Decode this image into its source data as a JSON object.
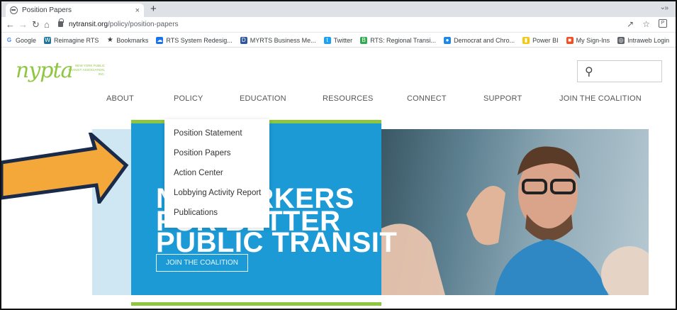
{
  "browser": {
    "tab_title": "Position Papers",
    "tab_close": "×",
    "new_tab": "+",
    "url_domain": "nytransit.org",
    "url_path": "/policy/position-papers"
  },
  "bookmarks": [
    {
      "label": "Google",
      "icon": "google-icon",
      "color": "#4285f4"
    },
    {
      "label": "Reimagine RTS",
      "icon": "wordpress-icon",
      "color": "#21759b"
    },
    {
      "label": "Bookmarks",
      "icon": "star-icon",
      "color": "#3c4043"
    },
    {
      "label": "RTS System Redesig...",
      "icon": "cloud-icon",
      "color": "#1a73e8"
    },
    {
      "label": "MYRTS Business Me...",
      "icon": "app-icon",
      "color": "#2b579a"
    },
    {
      "label": "Twitter",
      "icon": "twitter-icon",
      "color": "#1da1f2"
    },
    {
      "label": "RTS: Regional Transi...",
      "icon": "bus-icon",
      "color": "#34a853"
    },
    {
      "label": "Democrat and Chro...",
      "icon": "news-icon",
      "color": "#1e88e5"
    },
    {
      "label": "Power BI",
      "icon": "powerbi-icon",
      "color": "#f2c811"
    },
    {
      "label": "My Sign-Ins",
      "icon": "microsoft-icon",
      "color": "#f25022"
    },
    {
      "label": "Intraweb Login",
      "icon": "globe-icon",
      "color": "#5f6368"
    }
  ],
  "site": {
    "logo": "nypta",
    "logo_sub": "NEW YORK PUBLIC TRANSIT ASSOCIATION, INC.",
    "nav": [
      "ABOUT",
      "POLICY",
      "EDUCATION",
      "RESOURCES",
      "CONNECT",
      "SUPPORT",
      "JOIN THE COALITION"
    ],
    "dropdown": [
      "Position Statement",
      "Position Papers",
      "Action Center",
      "Lobbying Activity Report",
      "Publications"
    ],
    "hero_lines": [
      "NY WORKERS",
      "FOR BETTER",
      "PUBLIC TRANSIT"
    ],
    "hero_cta": "JOIN THE COALITION"
  },
  "colors": {
    "brand_green": "#8dc63f",
    "hero_blue": "#1b9ad6",
    "arrow_orange": "#f4a83a",
    "arrow_outline": "#1a2a4a"
  }
}
